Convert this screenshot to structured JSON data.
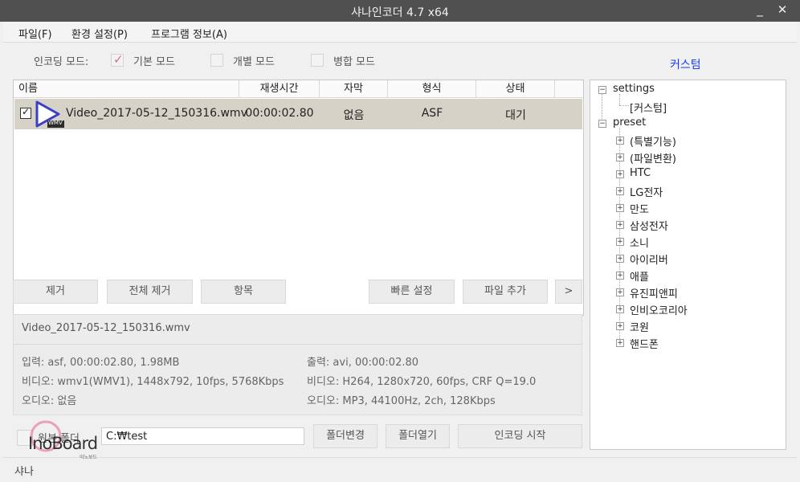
{
  "window": {
    "title": "샤나인코더 4.7 x64",
    "minimize": "_",
    "close": "✕"
  },
  "menu": [
    "파일(F)",
    "환경 설정(P)",
    "프로그램 정보(A)"
  ],
  "encoding_mode": {
    "label": "인코딩 모드:",
    "options": [
      {
        "label": "기본 모드",
        "checked": true
      },
      {
        "label": "개별 모드",
        "checked": false
      },
      {
        "label": "병합 모드",
        "checked": false
      }
    ]
  },
  "custom_link": "커스텀",
  "file_list": {
    "columns": [
      "이름",
      "재생시간",
      "자막",
      "형식",
      "상태"
    ],
    "rows": [
      {
        "name": "Video_2017-05-12_150316.wmv",
        "duration": "00:00:02.80",
        "subtitle": "없음",
        "format": "ASF",
        "status": "대기",
        "checked": true,
        "icon_text": "WMV"
      }
    ]
  },
  "buttons": {
    "remove": "제거",
    "remove_all": "전체 제거",
    "items": "항목",
    "quick_settings": "빠른 설정",
    "add_file": "파일 추가",
    "more": ">",
    "change_folder": "폴더변경",
    "open_folder": "폴더열기",
    "start_encoding": "인코딩 시작"
  },
  "info": {
    "filename": "Video_2017-05-12_150316.wmv",
    "input": "입력: asf, 00:00:02.80, 1.98MB",
    "input_video": "비디오: wmv1(WMV1), 1448x792, 10fps, 5768Kbps",
    "input_audio": "오디오: 없음",
    "output": "출력: avi, 00:00:02.80",
    "output_video": "비디오: H264, 1280x720, 60fps, CRF Q=19.0",
    "output_audio": "오디오: MP3, 44100Hz, 2ch, 128Kbps"
  },
  "output_folder": {
    "label": "원본 폴더",
    "path": "C:₩test",
    "checked": false
  },
  "tree": {
    "settings": {
      "label": "settings",
      "children": [
        "[커스텀]"
      ]
    },
    "preset": {
      "label": "preset",
      "children": [
        "(특별기능)",
        "(파일변환)",
        "HTC",
        "LG전자",
        "만도",
        "삼성전자",
        "소니",
        "아이리버",
        "애플",
        "유진피앤피",
        "인비오코리아",
        "코원",
        "핸드폰"
      ]
    }
  },
  "status_text": "샤나",
  "watermark": {
    "main": "InoBoard",
    "sub": "이노보드"
  },
  "colors": {
    "titlebar": "#505050",
    "accent_link": "#1a3cff",
    "check_pink": "#e0679b",
    "row_selected": "#d6d2c8",
    "play_icon": "#3a3ec8"
  }
}
